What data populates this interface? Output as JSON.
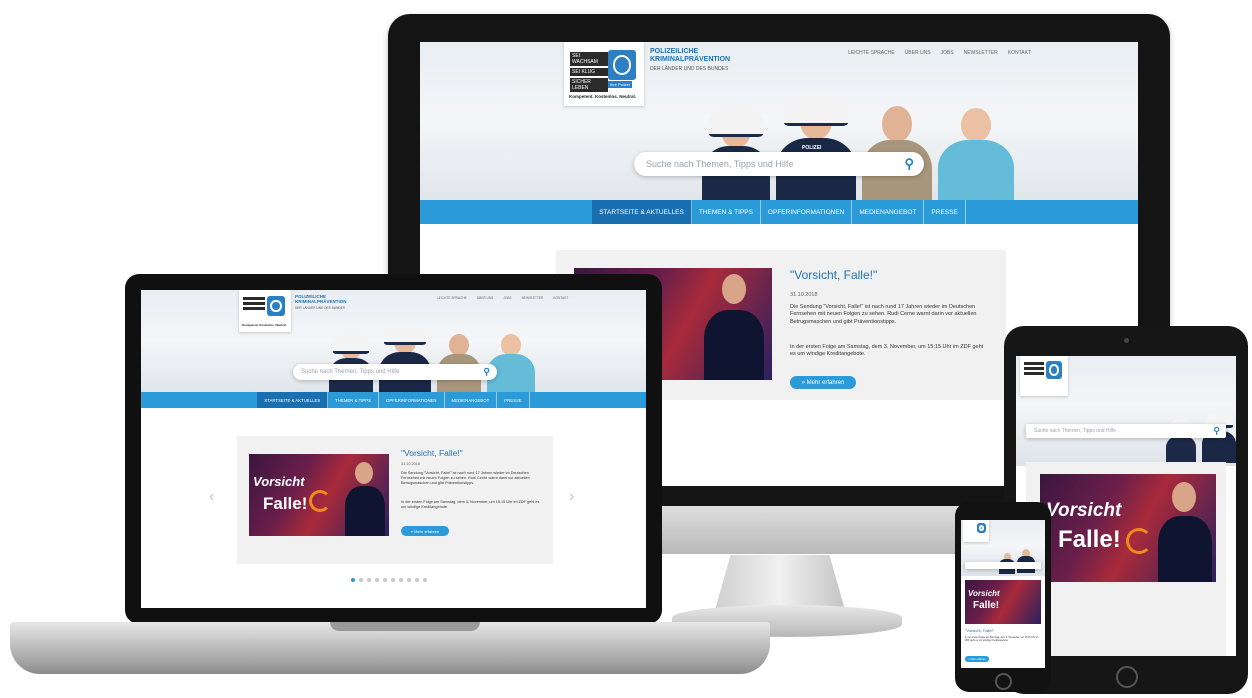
{
  "site": {
    "brand_title_1": "POLIZEILICHE",
    "brand_title_2": "KRIMINALPRÄVENTION",
    "brand_sub": "DER LÄNDER UND DES BUNDES",
    "logo_line_1": "SEI WACHSAM",
    "logo_line_2": "SEI KLUG",
    "logo_line_3": "SICHER LEBEN",
    "logo_badge": "Ihre Polizei",
    "logo_tagline": "Kompetent. Kostenlos. Neutral.",
    "police_label": "POLIZEI",
    "top_nav": [
      "LEICHTE SPRACHE",
      "ÜBER UNS",
      "JOBS",
      "NEWSLETTER",
      "KONTAKT"
    ],
    "search_placeholder": "Suche nach Themen, Tipps und Hilfe",
    "main_nav": [
      "STARTSEITE & AKTUELLES",
      "THEMEN & TIPPS",
      "OPFERINFORMATIONEN",
      "MEDIENANGEBOT",
      "PRESSE"
    ],
    "teaser": {
      "title": "\"Vorsicht, Falle!\"",
      "date": "31.10.2018",
      "p1": "Die Sendung \"Vorsicht, Falle!\" ist nach rund 17 Jahren wieder im Deutschen Fernsehen mit neuen Folgen zu sehen. Rudi Cerne warnt darin vor aktuellen Betrugsmaschen und gibt Präventionstipps.",
      "p2": "In der ersten Folge am Samstag, dem 3. November, um 15:15 Uhr im ZDF geht es um windige Kreditangebote.",
      "button": "» Mehr erfahren",
      "img_word1": "Vorsicht",
      "img_word2": "Falle!"
    }
  }
}
